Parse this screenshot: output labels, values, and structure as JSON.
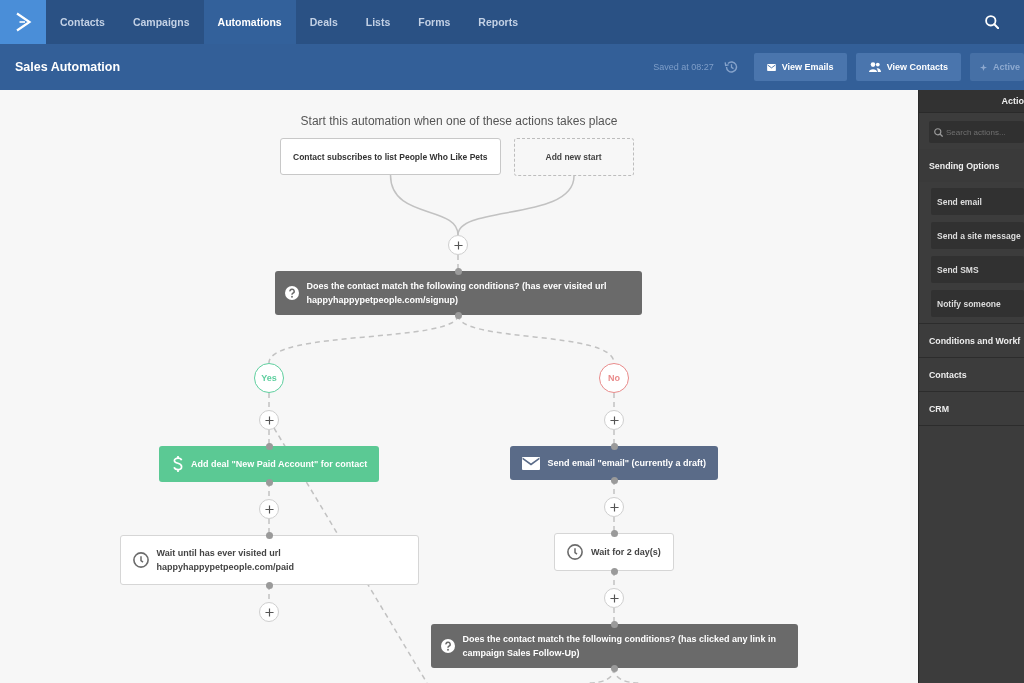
{
  "nav": {
    "items": [
      {
        "label": "Contacts",
        "selected": false
      },
      {
        "label": "Campaigns",
        "selected": false
      },
      {
        "label": "Automations",
        "selected": true
      },
      {
        "label": "Deals",
        "selected": false
      },
      {
        "label": "Lists",
        "selected": false
      },
      {
        "label": "Forms",
        "selected": false
      },
      {
        "label": "Reports",
        "selected": false
      }
    ]
  },
  "header": {
    "title": "Sales Automation",
    "saved_status": "Saved at 08:27",
    "buttons": [
      {
        "label": "View Emails",
        "kind": "emails"
      },
      {
        "label": "View Contacts",
        "kind": "contacts"
      },
      {
        "label": "Active",
        "kind": "status"
      }
    ]
  },
  "canvas": {
    "heading": "Start this automation when one of these actions takes place",
    "starts": [
      {
        "label": "Contact subscribes to list People Who Like Pets",
        "kind": "trigger"
      },
      {
        "label": "Add new start",
        "kind": "new"
      }
    ],
    "steps": [
      {
        "kind": "condition",
        "text": "Does the contact match the following conditions? (has ever visited url happyhappypetpeople.com/signup)",
        "branches": [
          {
            "label": "Yes",
            "color": "#5fcf9f",
            "steps": [
              {
                "kind": "deal",
                "text": "Add deal \"New Paid Account\" for contact"
              },
              {
                "kind": "wait",
                "text": "Wait until has ever visited url happyhappypetpeople.com/paid"
              }
            ]
          },
          {
            "label": "No",
            "color": "#e98b8b",
            "steps": [
              {
                "kind": "email",
                "text": "Send email \"email\" (currently a draft)"
              },
              {
                "kind": "wait",
                "text": "Wait for 2 day(s)"
              },
              {
                "kind": "condition",
                "text": "Does the contact match the following conditions? (has clicked any link in campaign Sales Follow-Up)"
              }
            ]
          }
        ]
      }
    ]
  },
  "panel": {
    "title": "Actio",
    "search": {
      "placeholder": "Search actions..."
    },
    "sections": [
      {
        "label": "Sending Options",
        "expanded": true,
        "items": [
          "Send email",
          "Send a site message",
          "Send SMS",
          "Notify someone"
        ]
      },
      {
        "label": "Conditions and Workf",
        "expanded": false
      },
      {
        "label": "Contacts",
        "expanded": false
      },
      {
        "label": "CRM",
        "expanded": false
      }
    ]
  }
}
